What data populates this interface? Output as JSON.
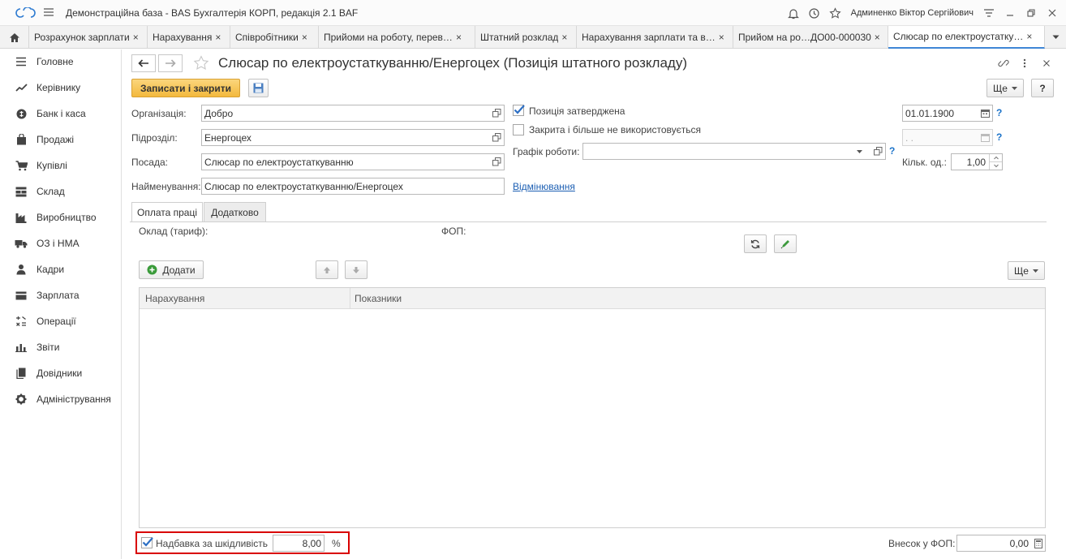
{
  "window": {
    "title": "Демонстраційна база - BAS Бухгалтерія КОРП, редакція 2.1 BAF",
    "user": "Админенко Віктор Сергійович"
  },
  "tabs": [
    {
      "label": "Розрахунок зарплати"
    },
    {
      "label": "Нарахування"
    },
    {
      "label": "Співробітники"
    },
    {
      "label": "Прийоми на роботу, перев…"
    },
    {
      "label": "Штатний розклад"
    },
    {
      "label": "Нарахування зарплати та в…"
    },
    {
      "label": "Прийом на ро…ДО00-000030"
    },
    {
      "label": "Слюсар по електроустатку…"
    }
  ],
  "tab_close": "×",
  "sidebar": {
    "items": [
      {
        "label": "Головне",
        "icon": "menu-lines-icon"
      },
      {
        "label": "Керівнику",
        "icon": "trend-icon"
      },
      {
        "label": "Банк і каса",
        "icon": "bank-icon"
      },
      {
        "label": "Продажі",
        "icon": "bag-icon"
      },
      {
        "label": "Купівлі",
        "icon": "cart-icon"
      },
      {
        "label": "Склад",
        "icon": "warehouse-icon"
      },
      {
        "label": "Виробництво",
        "icon": "factory-icon"
      },
      {
        "label": "ОЗ і НМА",
        "icon": "truck-icon"
      },
      {
        "label": "Кадри",
        "icon": "person-icon"
      },
      {
        "label": "Зарплата",
        "icon": "wallet-icon"
      },
      {
        "label": "Операції",
        "icon": "operations-icon"
      },
      {
        "label": "Звіти",
        "icon": "bars-icon"
      },
      {
        "label": "Довідники",
        "icon": "books-icon"
      },
      {
        "label": "Адміністрування",
        "icon": "gear-icon"
      }
    ]
  },
  "form": {
    "title": "Слюсар по електроустаткуванню/Енергоцех (Позиція штатного розкладу)",
    "save_close_label": "Записати і закрити",
    "more_label": "Ще",
    "help_label": "?",
    "organization_label": "Організація:",
    "organization_value": "Добро",
    "department_label": "Підрозділ:",
    "department_value": "Енергоцех",
    "position_label": "Посада:",
    "position_value": "Слюсар по електроустаткуванню",
    "name_label": "Найменування:",
    "name_value": "Слюсар по електроустаткуванню/Енергоцех",
    "approved_label": "Позиція затверджена",
    "approved_checked": true,
    "approved_date": "01.01.1900",
    "closed_label": "Закрита і більше не використовується",
    "closed_checked": false,
    "closed_date_placeholder": ". .",
    "schedule_label": "Графік роботи:",
    "schedule_value": "",
    "units_label": "Кільк. од.:",
    "units_value": "1,00",
    "declension_link": "Відмінювання",
    "qmark": "?"
  },
  "inner_tabs": [
    {
      "label": "Оплата праці"
    },
    {
      "label": "Додатково"
    }
  ],
  "pay": {
    "salary_label": "Оклад (тариф):",
    "fop_label": "ФОП:",
    "add_label": "Додати",
    "more_label": "Ще",
    "columns": [
      "Нарахування",
      "Показники"
    ],
    "rows": [],
    "harm_label": "Надбавка за шкідливість",
    "harm_checked": true,
    "harm_value": "8,00",
    "harm_unit": "%",
    "fop_contrib_label": "Внесок у ФОП:",
    "fop_contrib_value": "0,00"
  },
  "colors": {
    "accent": "#3f86d6",
    "primary_button": "#f3b93d",
    "highlight": "#d90000",
    "link": "#1c5fb3"
  }
}
